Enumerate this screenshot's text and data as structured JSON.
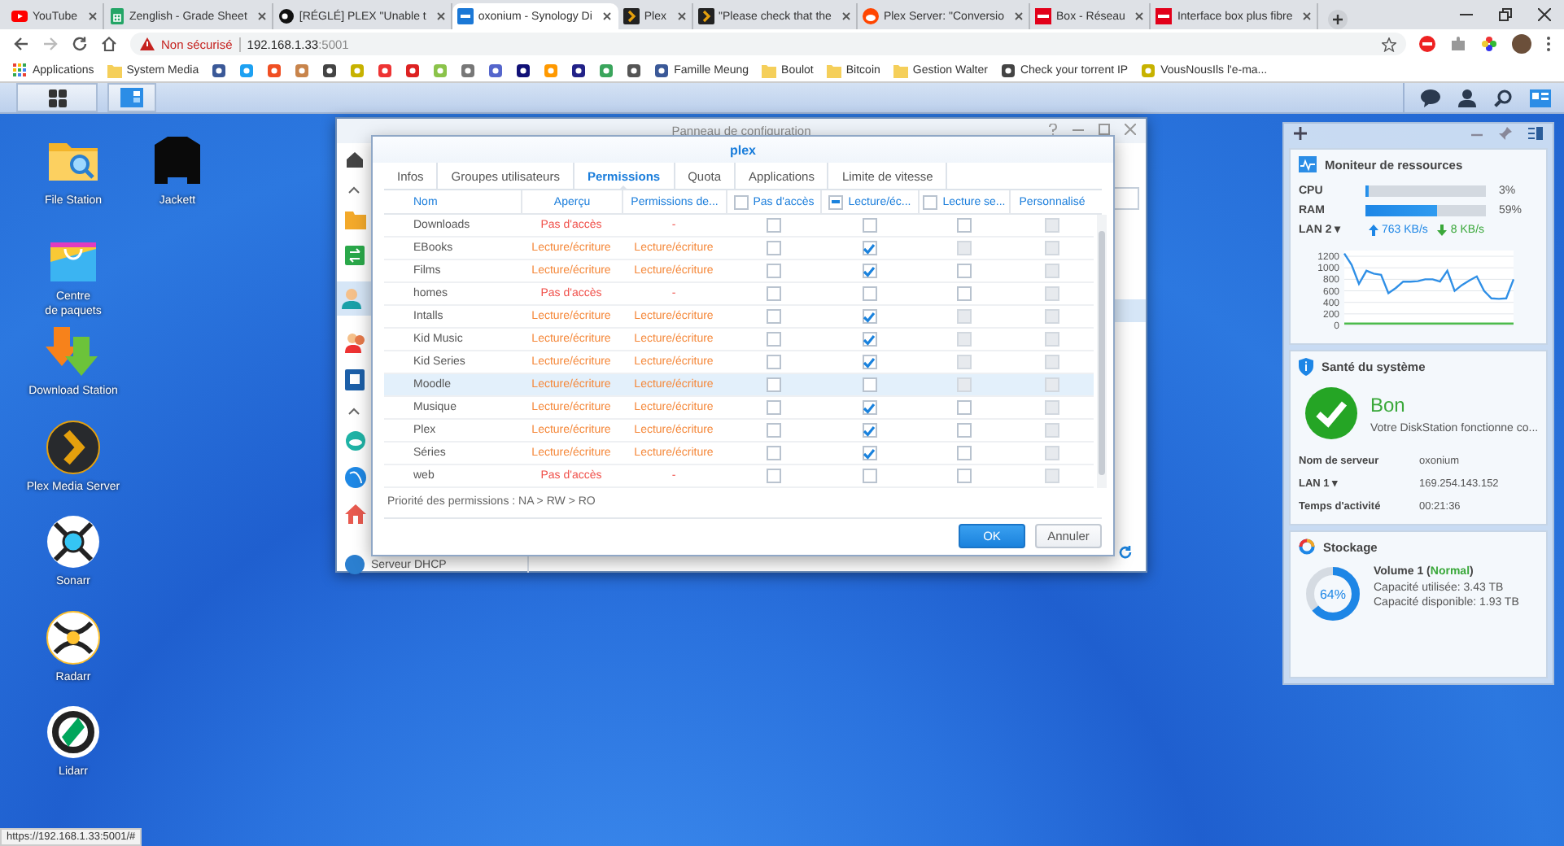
{
  "browser": {
    "tabs": [
      {
        "title": "YouTube",
        "kind": "youtube",
        "selected": false
      },
      {
        "title": "Zenglish - Grade Sheet",
        "kind": "sheet",
        "selected": false
      },
      {
        "title": "[RÉGLÉ] PLEX \"Unable t",
        "kind": "dark",
        "selected": false
      },
      {
        "title": "oxonium - Synology Di",
        "kind": "synology",
        "selected": true
      },
      {
        "title": "Plex",
        "kind": "plex",
        "selected": false
      },
      {
        "title": "\"Please check that the",
        "kind": "plex",
        "selected": false
      },
      {
        "title": "Plex Server: \"Conversio",
        "kind": "reddit",
        "selected": false
      },
      {
        "title": "Box - Réseau",
        "kind": "sfr",
        "selected": false
      },
      {
        "title": "Interface box plus fibre",
        "kind": "sfr",
        "selected": false
      }
    ],
    "address": {
      "security": "Non sécurisé",
      "host": "192.168.1.33",
      "port": ":5001"
    },
    "bookmarks": [
      {
        "label": "Applications",
        "kind": "apps"
      },
      {
        "label": "System Media",
        "kind": "folder"
      },
      {
        "kind": "site"
      },
      {
        "kind": "site"
      },
      {
        "kind": "site"
      },
      {
        "kind": "site"
      },
      {
        "kind": "site"
      },
      {
        "kind": "site"
      },
      {
        "kind": "site"
      },
      {
        "kind": "site"
      },
      {
        "kind": "site"
      },
      {
        "kind": "site"
      },
      {
        "kind": "site"
      },
      {
        "kind": "site"
      },
      {
        "kind": "site"
      },
      {
        "kind": "site"
      },
      {
        "kind": "site"
      },
      {
        "kind": "site"
      },
      {
        "label": "Famille Meung",
        "kind": "site"
      },
      {
        "label": "Boulot",
        "kind": "folder"
      },
      {
        "label": "Bitcoin",
        "kind": "folder"
      },
      {
        "label": "Gestion Walter",
        "kind": "folder"
      },
      {
        "label": "Check your torrent IP",
        "kind": "site"
      },
      {
        "label": "VousNousIls l'e-ma...",
        "kind": "site"
      }
    ],
    "status_url": "https://192.168.1.33:5001/#"
  },
  "desktop_icons": [
    [
      {
        "label": "File Station",
        "kind": "file"
      },
      {
        "label": "Centre\nde paquets",
        "kind": "package"
      },
      {
        "label": "Download Station",
        "kind": "download"
      },
      {
        "label": "Plex Media Server",
        "kind": "plex"
      },
      {
        "label": "Sonarr",
        "kind": "sonarr"
      },
      {
        "label": "Radarr",
        "kind": "radarr"
      },
      {
        "label": "Lidarr",
        "kind": "lidarr"
      }
    ],
    [
      {
        "label": "Jackett",
        "kind": "jackett"
      }
    ]
  ],
  "control_panel": {
    "title": "Panneau de configuration",
    "last_item": "Serveur DHCP"
  },
  "dialog": {
    "title": "plex",
    "tabs": [
      {
        "label": "Infos",
        "selected": false
      },
      {
        "label": "Groupes utilisateurs",
        "selected": false
      },
      {
        "label": "Permissions",
        "selected": true
      },
      {
        "label": "Quota",
        "selected": false
      },
      {
        "label": "Applications",
        "selected": false
      },
      {
        "label": "Limite de vitesse",
        "selected": false
      }
    ],
    "columns": [
      {
        "label": "Nom"
      },
      {
        "label": "Aperçu"
      },
      {
        "label": "Permissions de..."
      },
      {
        "label": "Pas d'accès",
        "checked": false,
        "indeterminate": false
      },
      {
        "label": "Lecture/éc...",
        "indeterminate": true
      },
      {
        "label": "Lecture se...",
        "checked": false,
        "indeterminate": false
      },
      {
        "label": "Personnalisé"
      }
    ],
    "rows": [
      {
        "name": "Downloads",
        "preview": "Pas d'accès",
        "color": "#f0504a",
        "effective": "-",
        "na": false,
        "rw": false,
        "ro": false,
        "ro_disabled": false,
        "custom_disabled": true,
        "selected": false
      },
      {
        "name": "EBooks",
        "preview": "Lecture/écriture",
        "color": "#f5883a",
        "effective": "Lecture/écriture",
        "na": false,
        "rw": true,
        "ro": false,
        "ro_disabled": true,
        "custom_disabled": true,
        "selected": false
      },
      {
        "name": "Films",
        "preview": "Lecture/écriture",
        "color": "#f5883a",
        "effective": "Lecture/écriture",
        "na": false,
        "rw": true,
        "ro": false,
        "ro_disabled": false,
        "custom_disabled": true,
        "selected": false
      },
      {
        "name": "homes",
        "preview": "Pas d'accès",
        "color": "#f0504a",
        "effective": "-",
        "na": false,
        "rw": false,
        "ro": false,
        "ro_disabled": false,
        "custom_disabled": true,
        "selected": false
      },
      {
        "name": "Intalls",
        "preview": "Lecture/écriture",
        "color": "#f5883a",
        "effective": "Lecture/écriture",
        "na": false,
        "rw": true,
        "ro": false,
        "ro_disabled": true,
        "custom_disabled": true,
        "selected": false
      },
      {
        "name": "Kid Music",
        "preview": "Lecture/écriture",
        "color": "#f5883a",
        "effective": "Lecture/écriture",
        "na": false,
        "rw": true,
        "ro": false,
        "ro_disabled": true,
        "custom_disabled": true,
        "selected": false
      },
      {
        "name": "Kid Series",
        "preview": "Lecture/écriture",
        "color": "#f5883a",
        "effective": "Lecture/écriture",
        "na": false,
        "rw": true,
        "ro": false,
        "ro_disabled": true,
        "custom_disabled": true,
        "selected": false
      },
      {
        "name": "Moodle",
        "preview": "Lecture/écriture",
        "color": "#f5883a",
        "effective": "Lecture/écriture",
        "na": false,
        "rw": false,
        "ro": false,
        "ro_disabled": true,
        "custom_disabled": true,
        "selected": true
      },
      {
        "name": "Musique",
        "preview": "Lecture/écriture",
        "color": "#f5883a",
        "effective": "Lecture/écriture",
        "na": false,
        "rw": true,
        "ro": false,
        "ro_disabled": false,
        "custom_disabled": true,
        "selected": false
      },
      {
        "name": "Plex",
        "preview": "Lecture/écriture",
        "color": "#f5883a",
        "effective": "Lecture/écriture",
        "na": false,
        "rw": true,
        "ro": false,
        "ro_disabled": false,
        "custom_disabled": true,
        "selected": false
      },
      {
        "name": "Séries",
        "preview": "Lecture/écriture",
        "color": "#f5883a",
        "effective": "Lecture/écriture",
        "na": false,
        "rw": true,
        "ro": false,
        "ro_disabled": false,
        "custom_disabled": true,
        "selected": false
      },
      {
        "name": "web",
        "preview": "Pas d'accès",
        "color": "#f0504a",
        "effective": "-",
        "na": false,
        "rw": false,
        "ro": false,
        "ro_disabled": false,
        "custom_disabled": true,
        "selected": false
      }
    ],
    "footer": "Priorité des permissions : NA > RW > RO",
    "buttons": [
      {
        "label": "OK",
        "kind": "primary"
      },
      {
        "label": "Annuler",
        "kind": "secondary"
      }
    ]
  },
  "widgets": {
    "resource_monitor": {
      "title": "Moniteur de ressources",
      "meters": [
        {
          "label": "CPU",
          "level": 0.03,
          "reading": "3%"
        },
        {
          "label": "RAM",
          "level": 0.59,
          "reading": "59%"
        }
      ],
      "interface": "LAN 2 ▾",
      "upload": "763 KB/s",
      "download": "8 KB/s",
      "chart_data": {
        "type": "line",
        "grid": true,
        "ylim": [
          0,
          1300
        ],
        "yticks": [
          0,
          200,
          400,
          600,
          800,
          1000,
          1200
        ],
        "series": [
          {
            "color": "#2f8fe6",
            "values": [
              1250,
              1050,
              720,
              950,
              900,
              880,
              560,
              650,
              760,
              760,
              770,
              800,
              800,
              760,
              950,
              600,
              700,
              780,
              850,
              600,
              470,
              460,
              470,
              800
            ]
          },
          {
            "color": "#4cbb4c",
            "values": [
              30,
              30,
              30,
              30,
              30,
              30,
              30,
              30,
              30,
              30,
              30,
              30,
              30,
              30,
              30,
              30,
              30,
              30,
              30,
              30,
              30,
              30,
              30,
              30
            ]
          }
        ]
      }
    },
    "health": {
      "title": "Santé du système",
      "status": "Bon",
      "message": "Votre DiskStation fonctionne co...",
      "rows": [
        {
          "label": "Nom de serveur",
          "value": "oxonium"
        },
        {
          "label": "LAN 1 ▾",
          "value": "169.254.143.152"
        },
        {
          "label": "Temps d'activité",
          "value": "00:21:36"
        }
      ]
    },
    "storage": {
      "title": "Stockage",
      "level": 0.64,
      "percent": "64%",
      "volume_before": "Volume 1 (",
      "volume_status": "Normal",
      "volume_after": ")",
      "used": "Capacité utilisée: 3.43 TB",
      "free": "Capacité disponible: 1.93 TB"
    }
  }
}
